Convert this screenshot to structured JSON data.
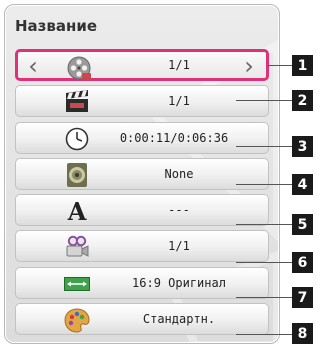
{
  "panel": {
    "title": "Название"
  },
  "rows": [
    {
      "id": 1,
      "icon": "film-reel-icon",
      "value": "1/1",
      "selected": true
    },
    {
      "id": 2,
      "icon": "clapperboard-icon",
      "value": "1/1",
      "selected": false
    },
    {
      "id": 3,
      "icon": "clock-icon",
      "value": "0:00:11/0:06:36",
      "selected": false
    },
    {
      "id": 4,
      "icon": "speaker-icon",
      "value": "None",
      "selected": false
    },
    {
      "id": 5,
      "icon": "subtitle-letter-icon",
      "value": "---",
      "selected": false
    },
    {
      "id": 6,
      "icon": "camera-angle-icon",
      "value": "1/1",
      "selected": false
    },
    {
      "id": 7,
      "icon": "aspect-ratio-icon",
      "value": "16:9 Оригинал",
      "selected": false
    },
    {
      "id": 8,
      "icon": "palette-icon",
      "value": "Стандартн.",
      "selected": false
    }
  ],
  "callouts": [
    "1",
    "2",
    "3",
    "4",
    "5",
    "6",
    "7",
    "8"
  ],
  "colors": {
    "selection": "#e0307a",
    "callout_bg": "#1a1a1a"
  }
}
